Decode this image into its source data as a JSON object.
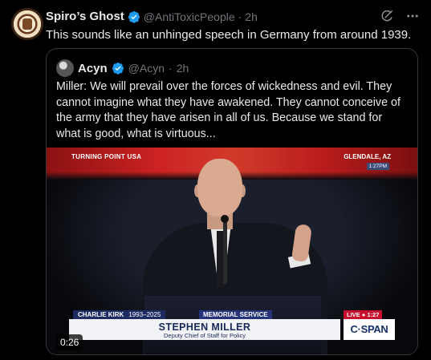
{
  "tweet": {
    "author_name": "Spiro’s Ghost",
    "handle": "@AntiToxicPeople",
    "separator": "·",
    "time": "2h",
    "text": "This sounds like an unhinged speech in Germany from around 1939."
  },
  "quoted_tweet": {
    "author_name": "Acyn",
    "handle": "@Acyn",
    "separator": "·",
    "time": "2h",
    "text": "Miller: We will prevail over the forces of wickedness and evil. They cannot imagine what they have awakened. They cannot conceive of the army that they have arisen in all of us. Because we stand for what is good, what is virtuous..."
  },
  "video": {
    "stage_label": "TURNING POINT USA",
    "location": "GLENDALE, AZ",
    "clock": "1:27",
    "clock_suffix": "PM",
    "lower_third": {
      "memorial_name": "CHARLIE KIRK",
      "years": "1993–2025",
      "event": "MEMORIAL SERVICE",
      "speaker_name": "STEPHEN MILLER",
      "speaker_title": "Deputy Chief of Staff for Policy",
      "live_label": "LIVE",
      "live_time": "1:27",
      "network": "C·SPAN"
    },
    "duration": "0:26"
  },
  "colors": {
    "background": "#000000",
    "verified": "#1d9bf0",
    "muted_text": "#71767b",
    "primary_text": "#e7e9ea"
  },
  "icons": [
    "verified-badge-icon",
    "grok-icon",
    "more-icon"
  ]
}
